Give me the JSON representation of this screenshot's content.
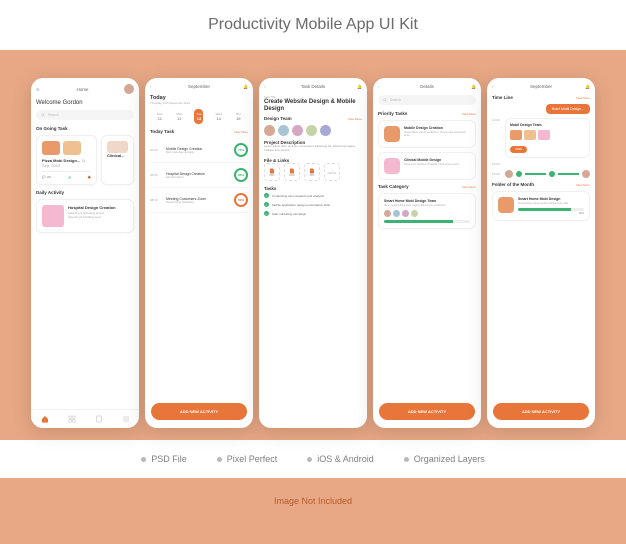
{
  "title": "Productivity Mobile App UI Kit",
  "features": [
    "PSD File",
    "Pixel Perfect",
    "iOS & Android",
    "Organized Layers"
  ],
  "footnote": "Image Not Included",
  "accent": "#e8763a",
  "screen1": {
    "header": "Home",
    "welcome": "Welcome Gordon",
    "search_ph": "Search",
    "sec1": "On Going Task",
    "card1_title": "Pizza Mobi Design...",
    "card1_date": "31 Sep. 2023",
    "card2_title": "Clinical...",
    "card_msg": "150",
    "sec2": "Daily Activity",
    "task1": "Hospital Design Creation",
    "task1_sub": "Selecting & uploading photos",
    "task1_sub2": "Selecting & installing icons"
  },
  "screen2": {
    "header": "September",
    "today": "Today",
    "today_sub": "Thursday, 12th September 2024",
    "dates": [
      {
        "d": "Sun",
        "n": "11"
      },
      {
        "d": "Mon",
        "n": "12"
      },
      {
        "d": "Tue",
        "n": "13"
      },
      {
        "d": "Wed",
        "n": "14"
      },
      {
        "d": "Thu",
        "n": "15"
      }
    ],
    "sec1": "Today Task",
    "vm": "View More",
    "t1_time": "07:00",
    "t1_name": "Mobile Design Creation",
    "t1_sub": "Start marketing campaign",
    "t1_pct": "75%",
    "t2_time": "08:00",
    "t2_name": "Hospital Design Creation",
    "t2_sub": "Add illustrations",
    "t2_pct": "90%",
    "t3_time": "08:30",
    "t3_name": "Meeting Customers Zoom",
    "t3_sub": "Design Photo Application",
    "t3_pct": "50%",
    "btn": "ADD NEW ACTIVITY"
  },
  "screen3": {
    "header": "Task Details",
    "crumb": "Task Title",
    "title": "Create Website Design & Mobile Design",
    "sec1": "Design Team",
    "vm": "View More",
    "sec2": "Project Description",
    "desc": "Lorem ipsum dolor sit amet, consectetur adipiscing elit. Adipiscing magna tristique arcu tempor.",
    "sec3": "File & Links",
    "files": [
      "PDF",
      "DOC",
      "JPG",
      "Add File"
    ],
    "sec4": "Tasks",
    "c1": "Conducting user research and analysis",
    "c2": "Mobile application design presentation slide",
    "c3": "Start marketing campaign"
  },
  "screen4": {
    "header": "Details",
    "search_ph": "Search",
    "sec1": "Priority Tasks",
    "vm": "View More",
    "p1_title": "Mobile Design Creation",
    "p1_desc": "Suspendisse varius vestibulum. Cursus eget fermentum amet.",
    "p2_title": "Clinical Mobile Design",
    "p2_desc": "Tempus ac faucibus. Pharetra morbi lacus et eros.",
    "sec2": "Task Category",
    "smart_title": "Smart Home Mobi Design Team",
    "smart_desc": "Nunc, suspendisse risus magna ullamcorper vestibulum.",
    "btn": "ADD NEW ACTIVITY"
  },
  "screen5": {
    "header": "September",
    "sec1": "Time Line",
    "vm": "View More",
    "tag": "Hotel Mobil Design...",
    "tcard_title": "Mobil Design Team",
    "tcard_open": "OPEN",
    "t1": "12:00",
    "t2": "13:00",
    "t3": "14:00",
    "sec2": "Folder of the Month",
    "f_title": "Smart Home Mobi Design",
    "f_desc": "Suspendisse varius amet in fames proin vitae.",
    "f_pct": "80%",
    "btn": "ADD NEW ACTIVITY"
  }
}
